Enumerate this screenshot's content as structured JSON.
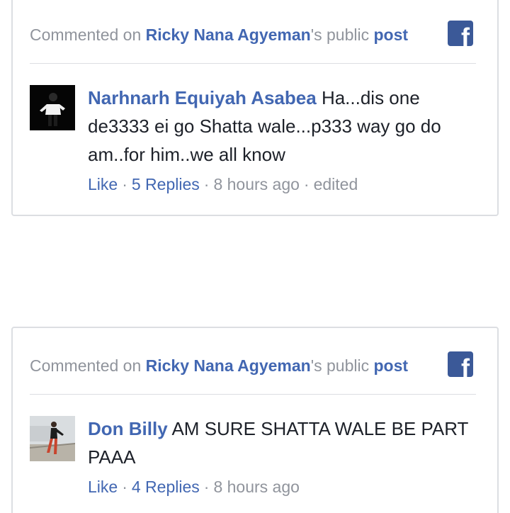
{
  "comments": [
    {
      "header": {
        "prefix": "Commented on ",
        "page_name": "Ricky Nana Agyeman",
        "suffix": "'s public ",
        "post_link": "post"
      },
      "author": "Narhnarh Equiyah Asabea",
      "text": "Ha...dis one de3333 ei go Shatta wale...p333 way go do am..for him..we all know",
      "like_label": "Like",
      "replies_label": "5 Replies",
      "time": "8 hours ago",
      "edited_label": "edited"
    },
    {
      "header": {
        "prefix": "Commented on ",
        "page_name": "Ricky Nana Agyeman",
        "suffix": "'s public ",
        "post_link": "post"
      },
      "author": "Don Billy",
      "text": "AM SURE SHATTA WALE BE PART PAAA",
      "like_label": "Like",
      "replies_label": "4 Replies",
      "time": "8 hours ago"
    }
  ],
  "facebook_logo_glyph": "f",
  "colors": {
    "link": "#4267b2",
    "muted": "#90949c",
    "text": "#1d2129",
    "facebook_brand": "#3b5998",
    "border": "#dcdee2"
  },
  "separator": "·"
}
